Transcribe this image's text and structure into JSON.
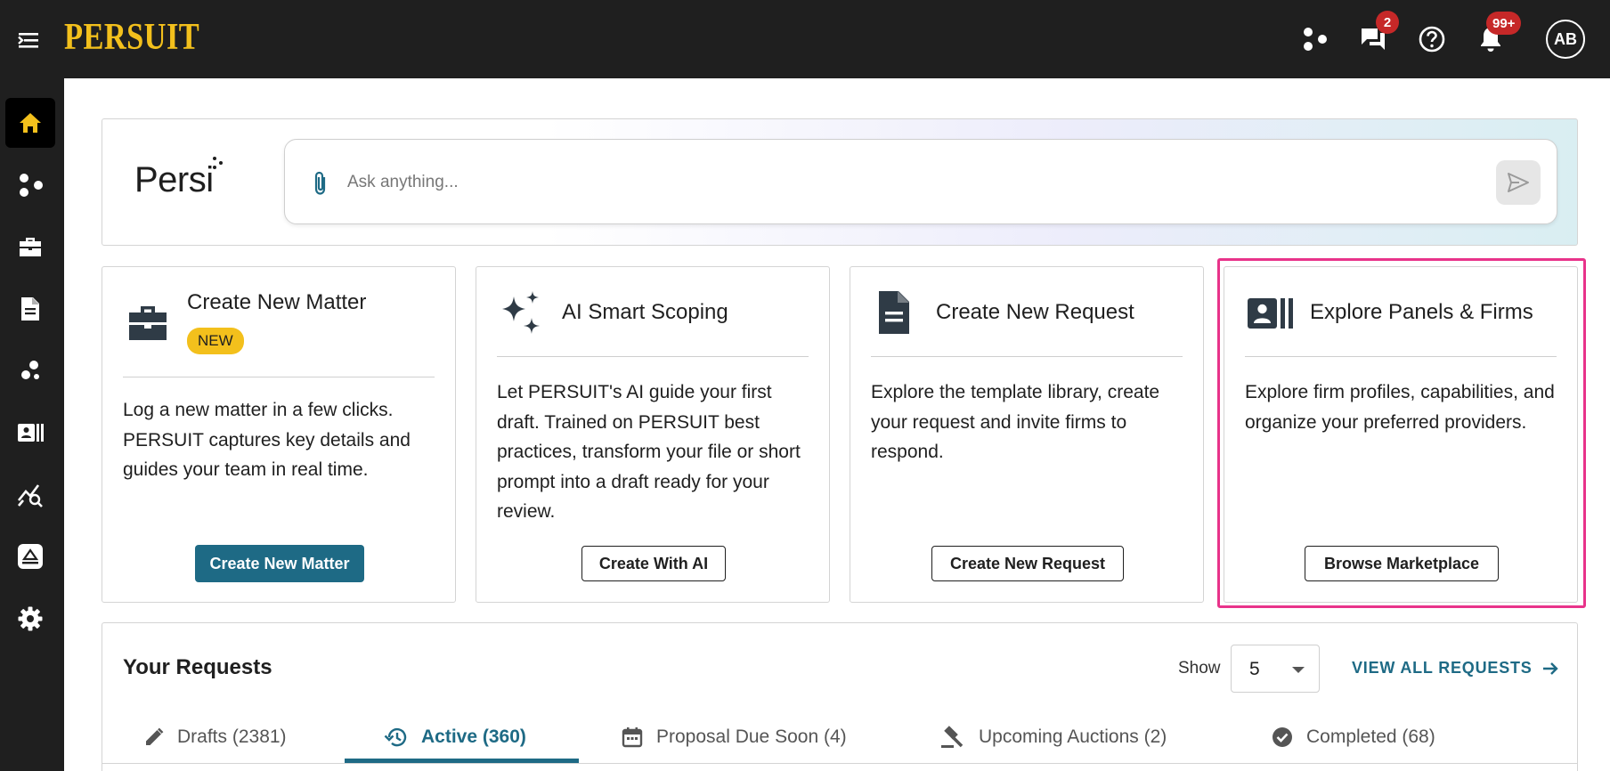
{
  "app": {
    "logo": "PERSUIT"
  },
  "topbar": {
    "messages_badge": "2",
    "notifications_badge": "99+",
    "avatar_initials": "AB"
  },
  "sidebar": {
    "items": [
      "home",
      "panels",
      "matters",
      "requests",
      "analytics",
      "firms",
      "insights",
      "marketplace",
      "settings"
    ],
    "active": "home"
  },
  "persi": {
    "logo": "Persi",
    "placeholder": "Ask anything..."
  },
  "cards": [
    {
      "title": "Create New Matter",
      "badge": "NEW",
      "description": "Log a new matter in a few clicks. PERSUIT captures key details and guides your team in real time.",
      "button": "Create New Matter"
    },
    {
      "title": "AI Smart Scoping",
      "description": "Let PERSUIT's AI guide your first draft. Trained on PERSUIT best practices, transform your file or short prompt into a draft ready for your review.",
      "button": "Create With AI"
    },
    {
      "title": "Create New Request",
      "description": "Explore the template library, create your request and invite firms to respond.",
      "button": "Create New Request"
    },
    {
      "title": "Explore Panels & Firms",
      "description": "Explore firm profiles, capabilities, and organize your preferred providers.",
      "button": "Browse Marketplace"
    }
  ],
  "requests": {
    "title": "Your Requests",
    "show_label": "Show",
    "show_value": "5",
    "view_all": "VIEW ALL REQUESTS",
    "tabs": [
      {
        "label": "Drafts (2381)"
      },
      {
        "label": "Active (360)"
      },
      {
        "label": "Proposal Due Soon (4)"
      },
      {
        "label": "Upcoming Auctions (2)"
      },
      {
        "label": "Completed (68)"
      }
    ],
    "active_tab": "Active (360)"
  },
  "colors": {
    "brand_yellow": "#f3c01c",
    "primary_teal": "#1e6a85",
    "highlight_pink": "#e8338a",
    "dark_bg": "#1f1f1f"
  }
}
